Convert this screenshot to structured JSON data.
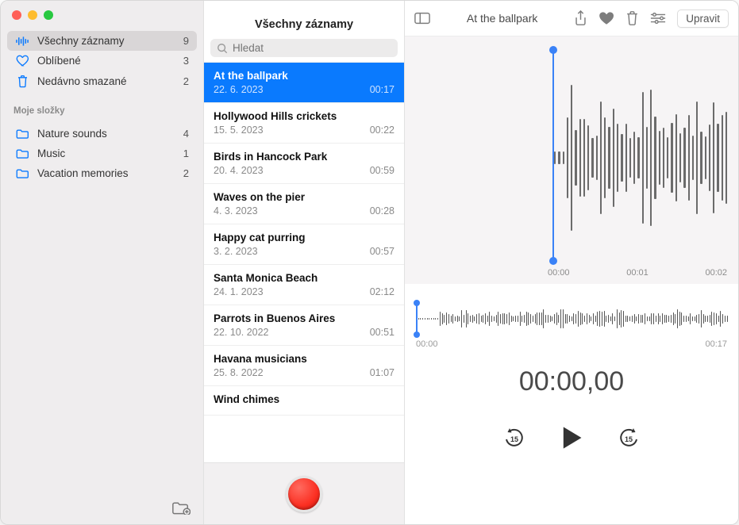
{
  "sidebar": {
    "smart": [
      {
        "id": "all",
        "label": "Všechny záznamy",
        "count": 9,
        "icon": "waveform-icon",
        "active": true
      },
      {
        "id": "fav",
        "label": "Oblíbené",
        "count": 3,
        "icon": "heart-icon",
        "active": false
      },
      {
        "id": "trash",
        "label": "Nedávno smazané",
        "count": 2,
        "icon": "trash-icon",
        "active": false
      }
    ],
    "section_label": "Moje složky",
    "folders": [
      {
        "label": "Nature sounds",
        "count": 4
      },
      {
        "label": "Music",
        "count": 1
      },
      {
        "label": "Vacation memories",
        "count": 2
      }
    ]
  },
  "list": {
    "title": "Všechny záznamy",
    "search_placeholder": "Hledat",
    "items": [
      {
        "title": "At the ballpark",
        "date": "22. 6. 2023",
        "duration": "00:17",
        "selected": true
      },
      {
        "title": "Hollywood Hills crickets",
        "date": "15. 5. 2023",
        "duration": "00:22"
      },
      {
        "title": "Birds in Hancock Park",
        "date": "20. 4. 2023",
        "duration": "00:59"
      },
      {
        "title": "Waves on the pier",
        "date": "4. 3. 2023",
        "duration": "00:28"
      },
      {
        "title": "Happy cat purring",
        "date": "3. 2. 2023",
        "duration": "00:57"
      },
      {
        "title": "Santa Monica Beach",
        "date": "24. 1. 2023",
        "duration": "02:12"
      },
      {
        "title": "Parrots in Buenos Aires",
        "date": "22. 10. 2022",
        "duration": "00:51"
      },
      {
        "title": "Havana musicians",
        "date": "25. 8. 2022",
        "duration": "01:07"
      },
      {
        "title": "Wind chimes",
        "date": "",
        "duration": ""
      }
    ]
  },
  "detail": {
    "title": "At the ballpark",
    "edit_label": "Upravit",
    "ruler": [
      "00:00",
      "00:01",
      "00:02"
    ],
    "overview": {
      "start": "00:00",
      "end": "00:17"
    },
    "timer": "00:00,00",
    "skip_value": "15",
    "colors": {
      "accent": "#0a7aff"
    }
  }
}
